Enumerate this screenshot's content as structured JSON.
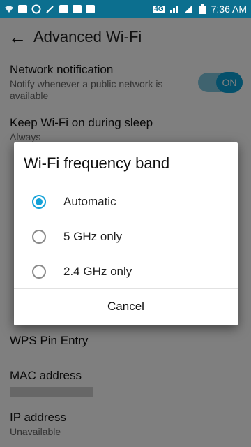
{
  "status_bar": {
    "network_label": "4G",
    "time": "7:36 AM",
    "icons": [
      "wifi-question-icon",
      "image-icon",
      "gauge-icon",
      "wand-icon",
      "bag-icon",
      "bag-icon",
      "bag-icon",
      "signal-icon",
      "battery-icon"
    ]
  },
  "toolbar": {
    "title": "Advanced Wi-Fi"
  },
  "prefs": {
    "network_notification": {
      "title": "Network notification",
      "summary": "Notify whenever a public network is available",
      "toggle_label": "ON"
    },
    "keep_wifi": {
      "title": "Keep Wi-Fi on during sleep",
      "summary": "Always"
    },
    "wps_pin": {
      "title": "WPS Pin Entry"
    },
    "mac_address": {
      "title": "MAC address"
    },
    "ip_address": {
      "title": "IP address",
      "summary": "Unavailable"
    }
  },
  "dialog": {
    "title": "Wi-Fi frequency band",
    "options": [
      {
        "label": "Automatic",
        "checked": true
      },
      {
        "label": "5 GHz only",
        "checked": false
      },
      {
        "label": "2.4 GHz only",
        "checked": false
      }
    ],
    "cancel_label": "Cancel"
  },
  "colors": {
    "status_bar": "#0c6f8f",
    "accent": "#14a2d8",
    "scrim": "rgba(0,0,0,0.5)"
  }
}
